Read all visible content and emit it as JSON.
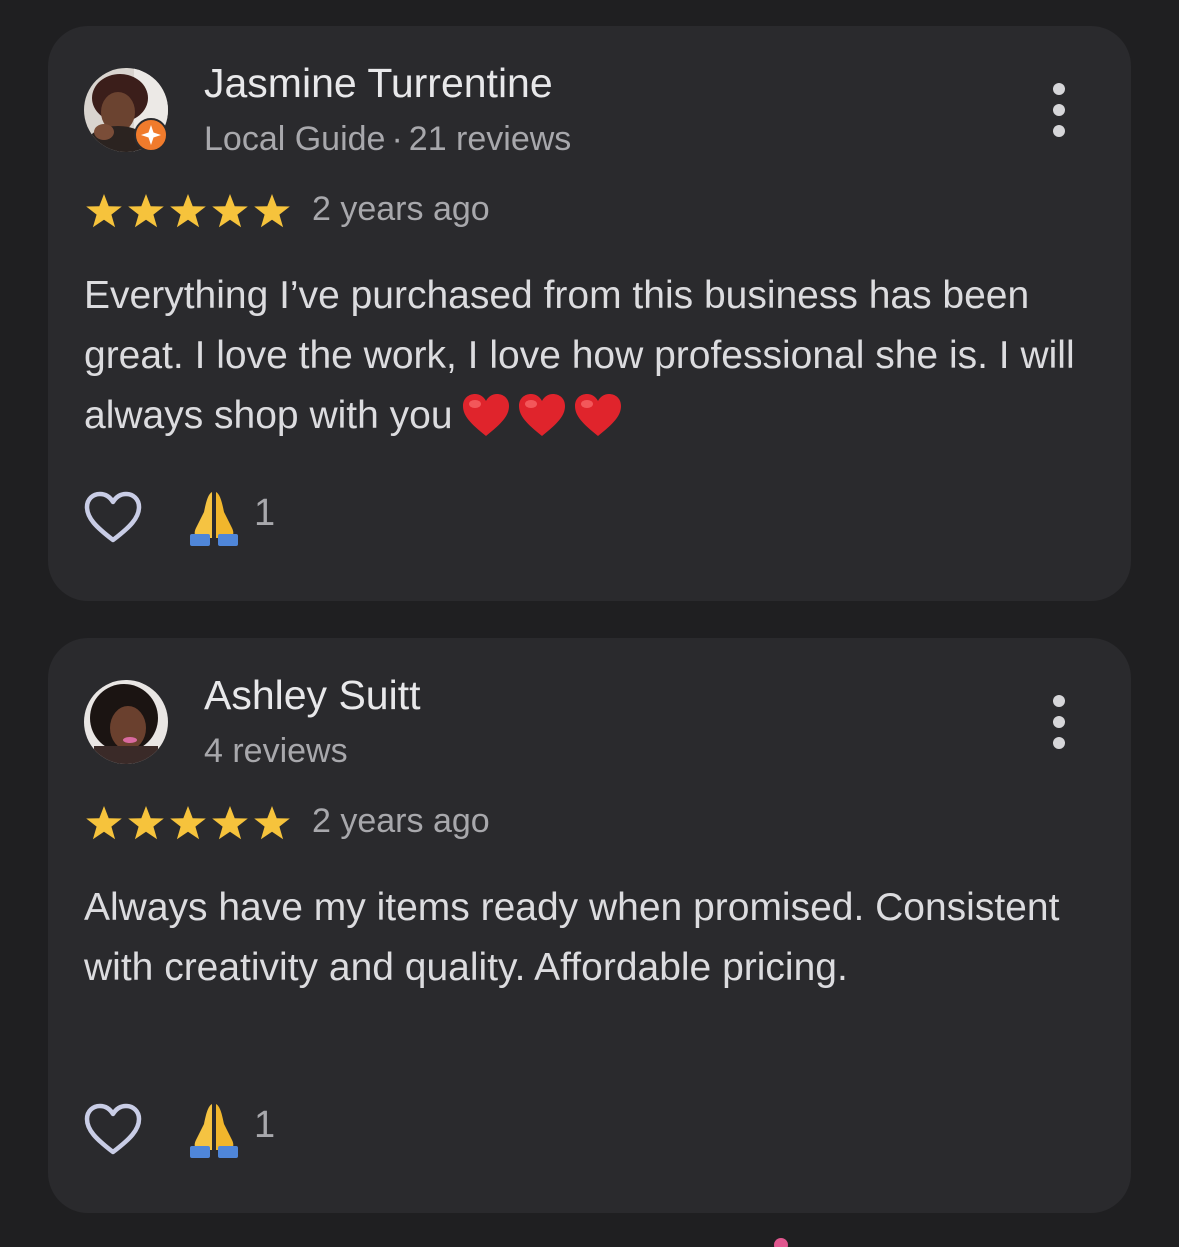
{
  "reviews": [
    {
      "name": "Jasmine Turrentine",
      "local_guide": "Local Guide",
      "separator": "·",
      "review_count": "21 reviews",
      "rating": 5,
      "time": "2 years ago",
      "text": "Everything I’ve purchased from this business has been great. I love the work, I love how professional she is. I will always shop with you",
      "reaction_count": "1"
    },
    {
      "name": "Ashley Suitt",
      "review_count": "4 reviews",
      "rating": 5,
      "time": "2 years ago",
      "text": "Always have my items ready when promised. Consistent with creativity and quality. Affordable pricing.",
      "reaction_count": "1"
    }
  ],
  "icons": {
    "menu": "more-vert-icon",
    "like": "heart-outline-icon",
    "reaction": "praying-hands-icon",
    "rating": "star-icon",
    "badge": "local-guide-badge-icon",
    "emoji": "red-heart-icon"
  },
  "colors": {
    "background": "#1f1f21",
    "card": "#2a2a2d",
    "star": "#f6c33c",
    "badge": "#f07b2c",
    "heart": "#e0242c"
  }
}
